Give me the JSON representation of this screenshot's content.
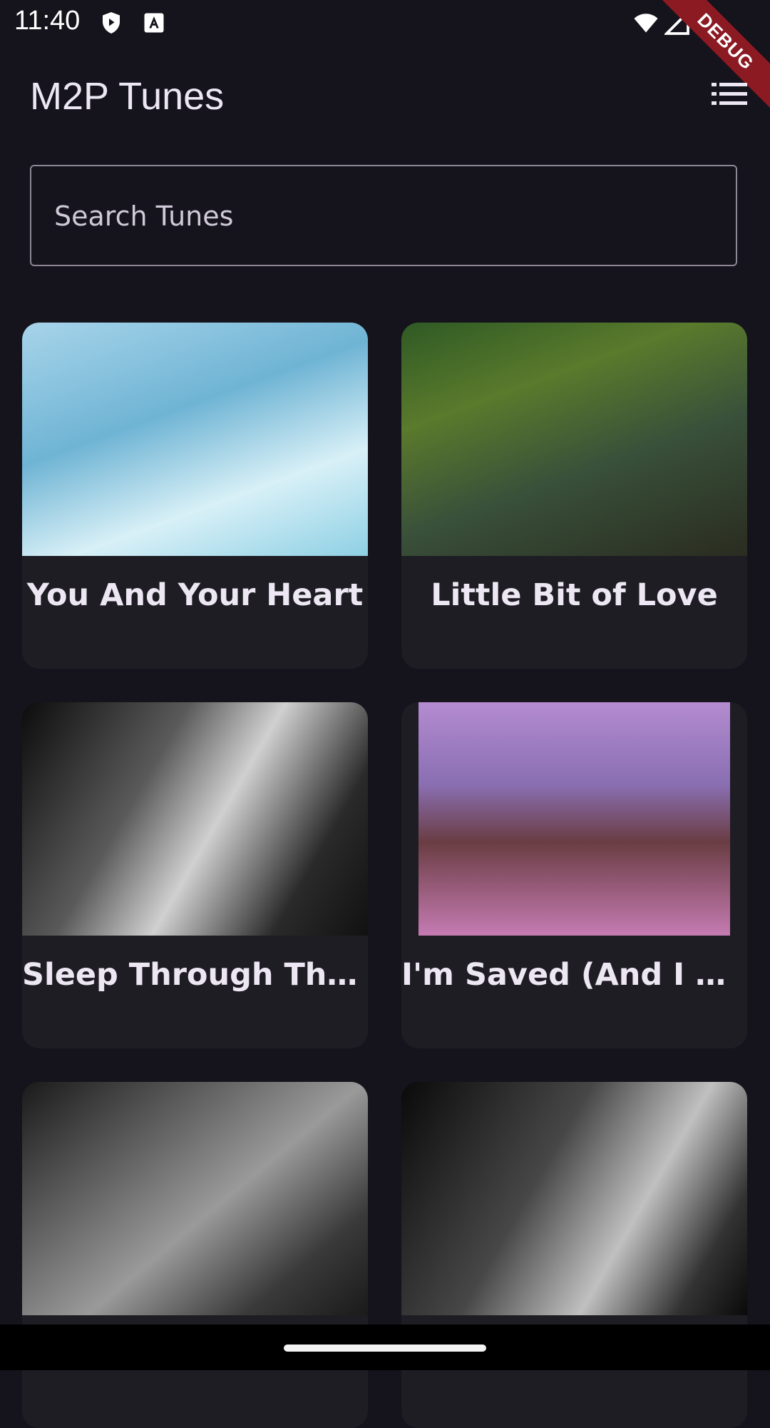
{
  "status_bar": {
    "time": "11:40",
    "icons": [
      "play-protect-icon",
      "font-a-icon",
      "wifi-icon",
      "signal-icon",
      "battery-icon"
    ],
    "debug_label": "DEBUG"
  },
  "app_bar": {
    "title": "M2P Tunes",
    "menu_icon": "list-view-icon"
  },
  "search": {
    "placeholder": "Search Tunes",
    "value": ""
  },
  "tunes": [
    {
      "title": "You And Your Heart",
      "thumbnail": "surfer-photo"
    },
    {
      "title": "Little Bit of Love",
      "thumbnail": "group-guitar-jungle-photo"
    },
    {
      "title": "Sleep Through The Static",
      "thumbnail": "studio-microphone-bw-photo"
    },
    {
      "title": "I'm Saved (And I Know It)",
      "thumbnail": "choir-stage-photo"
    },
    {
      "title": "",
      "thumbnail": "studio-guitar-bw-photo"
    },
    {
      "title": "",
      "thumbnail": "studio-mic-closeup-bw-photo"
    }
  ],
  "colors": {
    "background": "#15131b",
    "card": "#1f1d24",
    "text": "#ece7f2",
    "outline": "#8c8895",
    "debug_ribbon": "#8b1a22"
  }
}
